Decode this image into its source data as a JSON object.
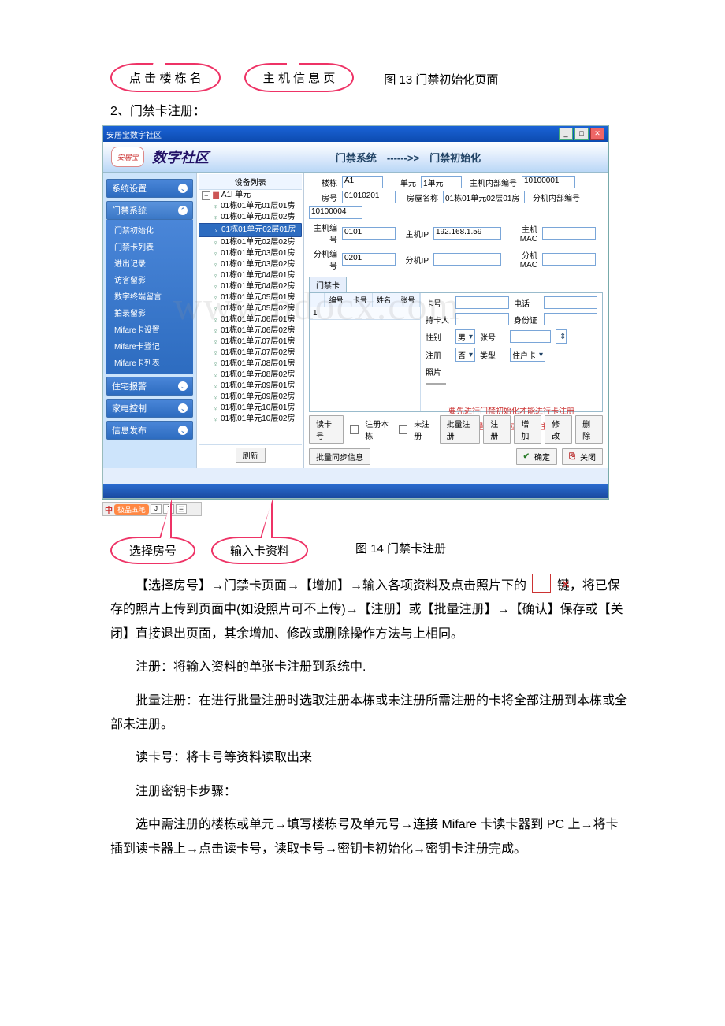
{
  "top_callouts": {
    "a": "点 击 楼 栋 名",
    "b": "主 机 信 息 页"
  },
  "fig13": "图 13 门禁初始化页面",
  "section_head": "2、门禁卡注册：",
  "app": {
    "title": "安居宝数字社区",
    "logo_text": "安居宝",
    "brand": "数字社区",
    "crumb": "门禁系统　------>>　门禁初始化",
    "nav": {
      "groups": [
        {
          "label": "系统设置",
          "expanded": false
        },
        {
          "label": "门禁系统",
          "expanded": true,
          "items": [
            "门禁初始化",
            "门禁卡列表",
            "进出记录",
            "访客留影",
            "数字终端留言",
            "拍录留影",
            "Mifare卡设置",
            "Mifare卡登记",
            "Mifare卡列表"
          ]
        },
        {
          "label": "住宅报警",
          "expanded": false
        },
        {
          "label": "家电控制",
          "expanded": false
        },
        {
          "label": "信息发布",
          "expanded": false
        }
      ]
    },
    "tree": {
      "title": "设备列表",
      "root": "A1l 单元",
      "rows": [
        "01栋01单元01层01房",
        "01栋01单元01层02房",
        "01栋01单元02层01房",
        "01栋01单元02层02房",
        "01栋01单元03层01房",
        "01栋01单元03层02房",
        "01栋01单元04层01房",
        "01栋01单元04层02房",
        "01栋01单元05层01房",
        "01栋01单元05层02房",
        "01栋01单元06层01房",
        "01栋01单元06层02房",
        "01栋01单元07层01房",
        "01栋01单元07层02房",
        "01栋01单元08层01房",
        "01栋01单元08层02房",
        "01栋01单元09层01房",
        "01栋01单元09层02房",
        "01栋01单元10层01房",
        "01栋01单元10层02房"
      ],
      "selected_index": 2,
      "refresh": "刷新"
    },
    "form": {
      "labels": {
        "building": "楼栋",
        "unit": "单元",
        "host_internal_no": "主机内部编号",
        "room": "房号",
        "room_name": "房屋名称",
        "ext_internal_no": "分机内部编号",
        "host_no": "主机编号",
        "host_ip": "主机IP",
        "host_mac": "主机MAC",
        "ext_no": "分机编号",
        "ext_ip": "分机IP",
        "ext_mac": "分机MAC"
      },
      "values": {
        "building": "A1",
        "unit": "1单元",
        "host_internal_no": "10100001",
        "room": "01010201",
        "room_name": "01栋01单元02层01房",
        "ext_internal_no": "10100004",
        "host_no": "0101",
        "host_ip": "192.168.1.59",
        "host_mac": "",
        "ext_no": "0201",
        "ext_ip": "",
        "ext_mac": ""
      },
      "tab": "门禁卡",
      "grid_headers": [
        "编号",
        "卡号",
        "姓名",
        "张号"
      ],
      "grid_first_cell": "1",
      "right": {
        "card_no": "卡号",
        "phone": "电话",
        "holder": "持卡人",
        "idcard": "身份证",
        "sex": "性别",
        "sex_val": "男",
        "zhang": "张号",
        "logout": "注册",
        "logout_val": "否",
        "type": "类型",
        "type_val": "住户卡",
        "photo": "照片"
      },
      "warn1": "要先进行门禁初始化才能进行卡注册",
      "warn2": "批量注册不包含通卡注册",
      "buttons": {
        "read_card": "读卡号",
        "chk_this": "注册本栋",
        "chk_unreg": "未注册",
        "batch_reg": "批量注册",
        "register": "注册",
        "add": "增加",
        "modify": "修改",
        "delete": "删除",
        "sync": "批量同步信息",
        "ok": "确定",
        "close": "关闭"
      }
    },
    "ime": {
      "pill": "极品五笔",
      "segs": [
        "J",
        "”",
        "三"
      ]
    }
  },
  "watermark": "www.bdocx.com",
  "bottom_callouts": {
    "a": "选择房号",
    "b": "输入卡资料"
  },
  "fig14": "图 14 门禁卡注册",
  "body_text": {
    "p1a": "【选择房号】→门禁卡页面→【增加】→输入各项资料及点击照片下的",
    "p1b": "键，将已保存的照片上传到页面中(如没照片可不上传)→【注册】或【批量注册】→【确认】保存或【关闭】直接退出页面，其余增加、修改或删除操作方法与上相同。",
    "p2": "注册：将输入资料的单张卡注册到系统中.",
    "p3": "批量注册：在进行批量注册时选取注册本栋或未注册所需注册的卡将全部注册到本栋或全部未注册。",
    "p4": "读卡号：将卡号等资料读取出来",
    "p5": "注册密钥卡步骤：",
    "p6": "选中需注册的楼栋或单元→填写楼栋号及单元号→连接 Mifare 卡读卡器到 PC 上→将卡插到读卡器上→点击读卡号，读取卡号→密钥卡初始化→密钥卡注册完成。"
  }
}
